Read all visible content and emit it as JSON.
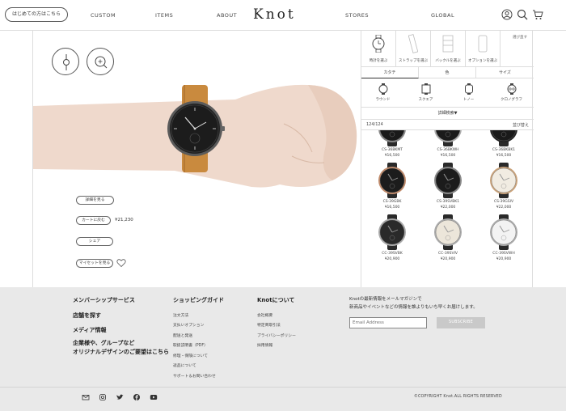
{
  "header": {
    "first_time": "はじめての方はこちら",
    "nav": [
      "CUSTOM",
      "ITEMS",
      "ABOUT",
      "STORES",
      "GLOBAL"
    ],
    "logo": "Knot"
  },
  "preview": {
    "details_label": "詳細を見る",
    "cart_label": "カートに戻む",
    "price": "¥21,230",
    "share_label": "シェア",
    "myset_label": "マイセットを見る"
  },
  "panel": {
    "categories": [
      "時計を選ぶ",
      "ストラップを選ぶ",
      "バックルを選ぶ",
      "オプションを選ぶ"
    ],
    "reset": "選び直す",
    "subtabs": [
      "カタチ",
      "色",
      "サイズ"
    ],
    "shapes": [
      "ラウンド",
      "スクエア",
      "トノー",
      "クロノグラフ"
    ],
    "detail_search": "詳細検索▼",
    "count": "124/124",
    "sort": "並び替え",
    "products": [
      {
        "name": "CS-36BKMT",
        "price": "¥16,500",
        "dial": "#1a1a1a",
        "case": "#888"
      },
      {
        "name": "CS-36BKWH",
        "price": "¥16,500",
        "dial": "#1a1a1a",
        "case": "#aaa"
      },
      {
        "name": "CS-36BKBK1",
        "price": "¥16,500",
        "dial": "#1a1a1a",
        "case": "#222"
      },
      {
        "name": "CS-39GBK",
        "price": "¥16,500",
        "dial": "#1c1c1c",
        "case": "#c08a6a"
      },
      {
        "name": "CS-39SVBK1",
        "price": "¥22,000",
        "dial": "#1c1c1c",
        "case": "#888"
      },
      {
        "name": "CS-39GSIV",
        "price": "¥22,000",
        "dial": "#f1ece2",
        "case": "#c9a27a"
      },
      {
        "name": "CC-39SVBK",
        "price": "¥20,900",
        "dial": "#2a2a2a",
        "case": "#aaa"
      },
      {
        "name": "CC-39SVIV",
        "price": "¥20,900",
        "dial": "#ece6da",
        "case": "#aaa"
      },
      {
        "name": "CC-39SVWH",
        "price": "¥20,900",
        "dial": "#f3f3f3",
        "case": "#aaa"
      }
    ]
  },
  "footer": {
    "col1": [
      "メンバーシップサービス",
      "店舗を探す",
      "メディア情報",
      "企業様や、グループなど",
      "オリジナルデザインのご要望はこちら"
    ],
    "col2_title": "ショッピングガイド",
    "col2": [
      "注文方法",
      "支払いオプション",
      "配送と発送",
      "取扱説明書（PDF）",
      "修理・保険について",
      "返品について",
      "サポート＆お問い合わせ"
    ],
    "col3_title": "Knotについて",
    "col3": [
      "会社概要",
      "特定商取引法",
      "プライバシーポリシー",
      "採用情報"
    ],
    "newsletter_line1": "Knotの最新情報をメールマガジンで",
    "newsletter_line2": "新商品やイベントなどの情報を誰よりもいち早くお届けします。",
    "email_placeholder": "Email Address",
    "subscribe": "SUBSCRIBE",
    "copyright": "©COPYRIGHT Knot.ALL RIGHTS RESERVED"
  }
}
